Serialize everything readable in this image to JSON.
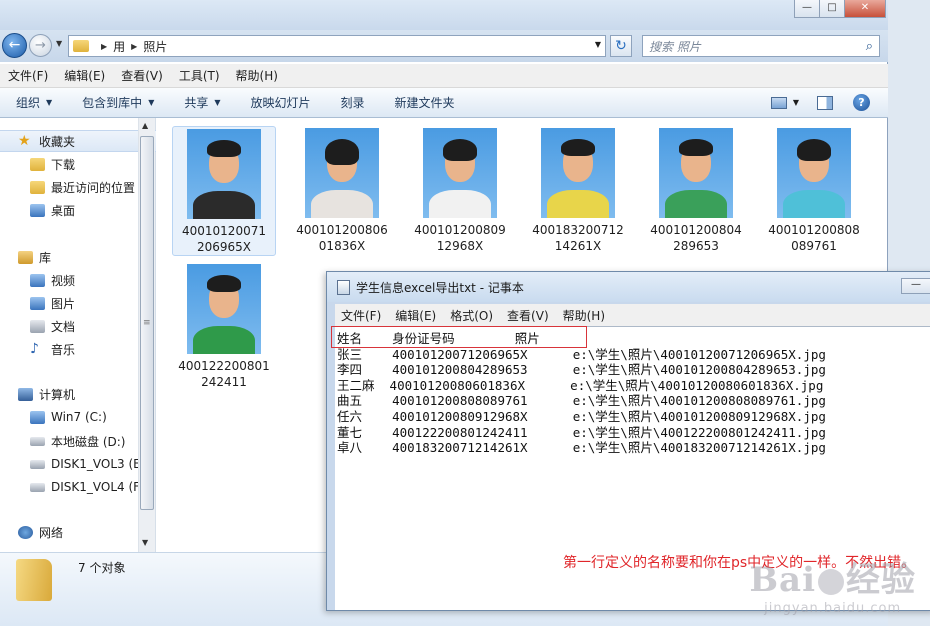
{
  "explorer": {
    "window_buttons": {
      "minimize": "—",
      "maximize": "□",
      "close": "✕"
    },
    "breadcrumb": [
      "用",
      "照片"
    ],
    "search_placeholder": "搜索 照片",
    "menu": [
      "文件(F)",
      "编辑(E)",
      "查看(V)",
      "工具(T)",
      "帮助(H)"
    ],
    "toolbar": {
      "organize": "组织",
      "include_library": "包含到库中",
      "share": "共享",
      "slideshow": "放映幻灯片",
      "burn": "刻录",
      "new_folder": "新建文件夹"
    },
    "nav": {
      "favorites": "收藏夹",
      "downloads": "下载",
      "recent": "最近访问的位置",
      "desktop": "桌面",
      "libraries": "库",
      "videos": "视频",
      "pictures": "图片",
      "documents": "文档",
      "music": "音乐",
      "computer": "计算机",
      "drive_c": "Win7 (C:)",
      "drive_d": "本地磁盘 (D:)",
      "drive_e": "DISK1_VOL3 (E:",
      "drive_f": "DISK1_VOL4 (F:",
      "network": "网络"
    },
    "files": [
      {
        "name": "40010120071206965X",
        "shirt": "#2b2b2b"
      },
      {
        "name": "40010120080601836X",
        "shirt": "#e7e3df"
      },
      {
        "name": "40010120080912968X",
        "shirt": "#f1f1f1"
      },
      {
        "name": "400183200712142 61X",
        "shirt": "#e8d54a"
      },
      {
        "name": "4001012008042 89653",
        "shirt": "#3aa05a"
      },
      {
        "name": "4001012008080 89761",
        "shirt": "#4fc0d8"
      },
      {
        "name": "4001222008012 42411",
        "shirt": "#2f9a4a"
      }
    ],
    "file_labels": [
      "40010120071206965X",
      "40010120080601836X",
      "40010120080912968X",
      "40018320071214261X",
      "400101200804289653",
      "400101200808089761",
      "400122200801242411"
    ],
    "status": "7 个对象"
  },
  "notepad": {
    "title": "学生信息excel导出txt - 记事本",
    "min_button": "—",
    "menu": [
      "文件(F)",
      "编辑(E)",
      "格式(O)",
      "查看(V)",
      "帮助(H)"
    ],
    "lines": [
      "姓名    身份证号码        照片",
      "张三    40010120071206965X      e:\\学生\\照片\\40010120071206965X.jpg",
      "李四    400101200804289653      e:\\学生\\照片\\400101200804289653.jpg",
      "王二麻  40010120080601836X      e:\\学生\\照片\\40010120080601836X.jpg",
      "曲五    400101200808089761      e:\\学生\\照片\\400101200808089761.jpg",
      "任六    40010120080912968X      e:\\学生\\照片\\40010120080912968X.jpg",
      "董七    400122200801242411      e:\\学生\\照片\\400122200801242411.jpg",
      "卓八    40018320071214261X      e:\\学生\\照片\\40018320071214261X.jpg"
    ],
    "annotation": "第一行定义的名称要和你在ps中定义的一样。不然出错。"
  },
  "watermark": {
    "main": "Bai",
    "main2": "经验",
    "sub": "jingyan.baidu.com"
  }
}
